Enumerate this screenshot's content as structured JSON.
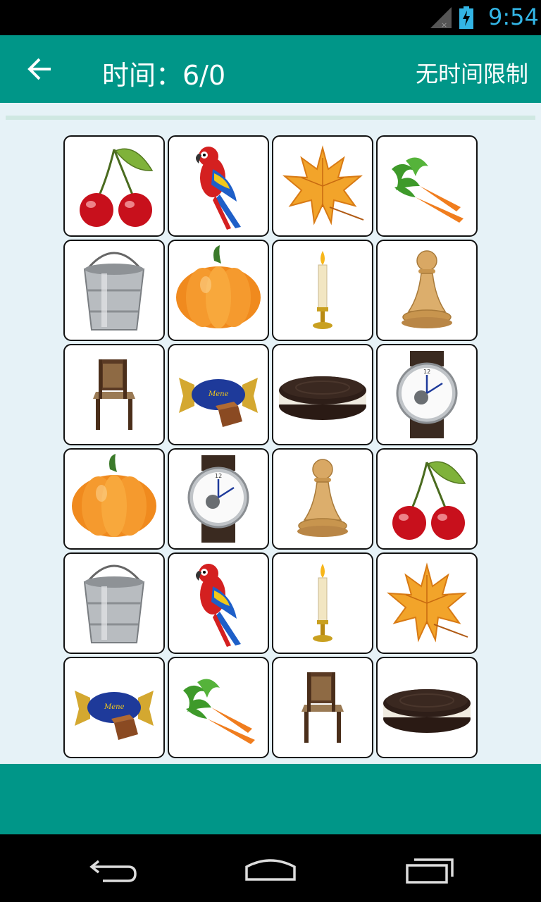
{
  "status_bar": {
    "time": "9:54",
    "icons": [
      "signal-icon",
      "battery-charging-icon"
    ]
  },
  "app_bar": {
    "back_icon": "arrow-left-icon",
    "title": "时间：6/0",
    "mode_label": "无时间限制"
  },
  "progress": {
    "fraction": 0.0
  },
  "board": {
    "columns": 4,
    "rows": 6,
    "cards": [
      {
        "item": "cherry"
      },
      {
        "item": "parrot"
      },
      {
        "item": "maple-leaf"
      },
      {
        "item": "carrot"
      },
      {
        "item": "bucket"
      },
      {
        "item": "pumpkin"
      },
      {
        "item": "candle"
      },
      {
        "item": "chess-pawn"
      },
      {
        "item": "chair"
      },
      {
        "item": "candy"
      },
      {
        "item": "cookie"
      },
      {
        "item": "watch"
      },
      {
        "item": "pumpkin"
      },
      {
        "item": "watch"
      },
      {
        "item": "chess-pawn"
      },
      {
        "item": "cherry"
      },
      {
        "item": "bucket"
      },
      {
        "item": "parrot"
      },
      {
        "item": "candle"
      },
      {
        "item": "maple-leaf"
      },
      {
        "item": "candy"
      },
      {
        "item": "carrot"
      },
      {
        "item": "chair"
      },
      {
        "item": "cookie"
      }
    ]
  },
  "nav_bar": {
    "icons": [
      "back-nav-icon",
      "home-nav-icon",
      "recents-nav-icon"
    ]
  },
  "colors": {
    "primary": "#009688",
    "background": "#e6f2f7",
    "status_accent": "#33b5e5"
  }
}
